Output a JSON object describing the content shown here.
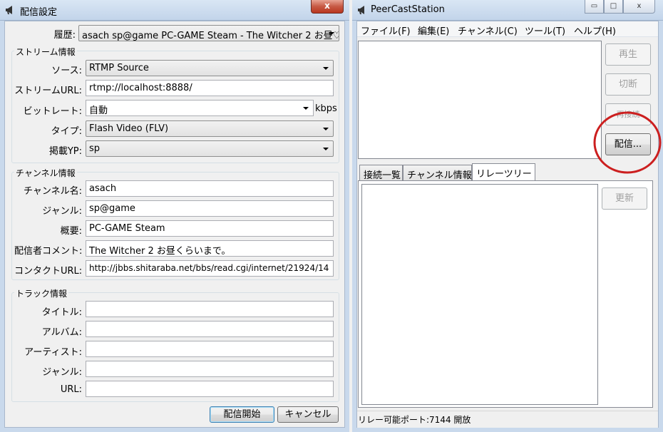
{
  "left_window": {
    "title": "配信設定",
    "close_symbol": "x",
    "history_label": "履歴:",
    "history_value": "asach sp@game PC-GAME Steam - The Witcher 2  お昼♡",
    "stream_group": "ストリーム情報",
    "source_label": "ソース:",
    "source_value": "RTMP Source",
    "stream_url_label": "ストリームURL:",
    "stream_url_value": "rtmp://localhost:8888/",
    "bitrate_label": "ビットレート:",
    "bitrate_value": "自動",
    "bitrate_unit": "kbps",
    "type_label": "タイプ:",
    "type_value": "Flash Video (FLV)",
    "yp_label": "掲載YP:",
    "yp_value": "sp",
    "channel_group": "チャンネル情報",
    "channel_name_label": "チャンネル名:",
    "channel_name_value": "asach",
    "genre_label": "ジャンル:",
    "genre_value": "sp@game",
    "summary_label": "概要:",
    "summary_value": "PC-GAME Steam",
    "comment_label": "配信者コメント:",
    "comment_value": "The Witcher 2  お昼くらいまで。",
    "contact_label": "コンタクトURL:",
    "contact_value": "http://jbbs.shitaraba.net/bbs/read.cgi/internet/21924/14",
    "track_group": "トラック情報",
    "track_title_label": "タイトル:",
    "track_album_label": "アルバム:",
    "track_artist_label": "アーティスト:",
    "track_genre_label": "ジャンル:",
    "track_url_label": "URL:",
    "start_button": "配信開始",
    "cancel_button": "キャンセル"
  },
  "right_window": {
    "title": "PeerCastStation",
    "minimize_symbol": "▭",
    "maximize_symbol": "□",
    "close_symbol": "x",
    "menu": [
      "ファイル(F)",
      "編集(E)",
      "チャンネル(C)",
      "ツール(T)",
      "ヘルプ(H)"
    ],
    "play_button": "再生",
    "disconnect_button": "切断",
    "reconnect_button": "再接続",
    "broadcast_button": "配信...",
    "tabs": [
      "接続一覧",
      "チャンネル情報",
      "リレーツリー"
    ],
    "update_button": "更新",
    "status": "リレー可能ポート:7144 開放"
  },
  "colors": {
    "annotation_circle": "#cc1f1f",
    "close_button": "#c75a45"
  }
}
